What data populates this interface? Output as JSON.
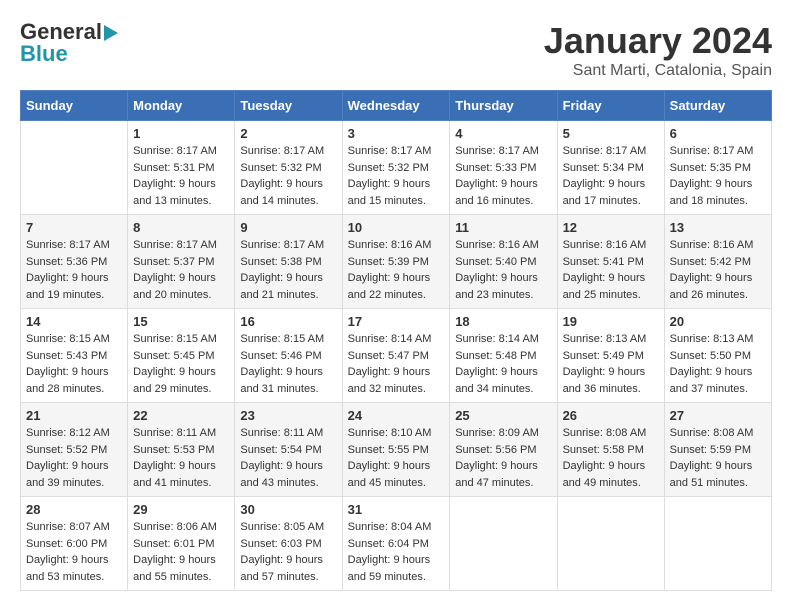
{
  "header": {
    "logo_line1": "General",
    "logo_line2": "Blue",
    "month": "January 2024",
    "location": "Sant Marti, Catalonia, Spain"
  },
  "weekdays": [
    "Sunday",
    "Monday",
    "Tuesday",
    "Wednesday",
    "Thursday",
    "Friday",
    "Saturday"
  ],
  "weeks": [
    [
      {
        "day": "",
        "info": ""
      },
      {
        "day": "1",
        "sunrise": "8:17 AM",
        "sunset": "5:31 PM",
        "daylight": "9 hours and 13 minutes."
      },
      {
        "day": "2",
        "sunrise": "8:17 AM",
        "sunset": "5:32 PM",
        "daylight": "9 hours and 14 minutes."
      },
      {
        "day": "3",
        "sunrise": "8:17 AM",
        "sunset": "5:32 PM",
        "daylight": "9 hours and 15 minutes."
      },
      {
        "day": "4",
        "sunrise": "8:17 AM",
        "sunset": "5:33 PM",
        "daylight": "9 hours and 16 minutes."
      },
      {
        "day": "5",
        "sunrise": "8:17 AM",
        "sunset": "5:34 PM",
        "daylight": "9 hours and 17 minutes."
      },
      {
        "day": "6",
        "sunrise": "8:17 AM",
        "sunset": "5:35 PM",
        "daylight": "9 hours and 18 minutes."
      }
    ],
    [
      {
        "day": "7",
        "sunrise": "8:17 AM",
        "sunset": "5:36 PM",
        "daylight": "9 hours and 19 minutes."
      },
      {
        "day": "8",
        "sunrise": "8:17 AM",
        "sunset": "5:37 PM",
        "daylight": "9 hours and 20 minutes."
      },
      {
        "day": "9",
        "sunrise": "8:17 AM",
        "sunset": "5:38 PM",
        "daylight": "9 hours and 21 minutes."
      },
      {
        "day": "10",
        "sunrise": "8:16 AM",
        "sunset": "5:39 PM",
        "daylight": "9 hours and 22 minutes."
      },
      {
        "day": "11",
        "sunrise": "8:16 AM",
        "sunset": "5:40 PM",
        "daylight": "9 hours and 23 minutes."
      },
      {
        "day": "12",
        "sunrise": "8:16 AM",
        "sunset": "5:41 PM",
        "daylight": "9 hours and 25 minutes."
      },
      {
        "day": "13",
        "sunrise": "8:16 AM",
        "sunset": "5:42 PM",
        "daylight": "9 hours and 26 minutes."
      }
    ],
    [
      {
        "day": "14",
        "sunrise": "8:15 AM",
        "sunset": "5:43 PM",
        "daylight": "9 hours and 28 minutes."
      },
      {
        "day": "15",
        "sunrise": "8:15 AM",
        "sunset": "5:45 PM",
        "daylight": "9 hours and 29 minutes."
      },
      {
        "day": "16",
        "sunrise": "8:15 AM",
        "sunset": "5:46 PM",
        "daylight": "9 hours and 31 minutes."
      },
      {
        "day": "17",
        "sunrise": "8:14 AM",
        "sunset": "5:47 PM",
        "daylight": "9 hours and 32 minutes."
      },
      {
        "day": "18",
        "sunrise": "8:14 AM",
        "sunset": "5:48 PM",
        "daylight": "9 hours and 34 minutes."
      },
      {
        "day": "19",
        "sunrise": "8:13 AM",
        "sunset": "5:49 PM",
        "daylight": "9 hours and 36 minutes."
      },
      {
        "day": "20",
        "sunrise": "8:13 AM",
        "sunset": "5:50 PM",
        "daylight": "9 hours and 37 minutes."
      }
    ],
    [
      {
        "day": "21",
        "sunrise": "8:12 AM",
        "sunset": "5:52 PM",
        "daylight": "9 hours and 39 minutes."
      },
      {
        "day": "22",
        "sunrise": "8:11 AM",
        "sunset": "5:53 PM",
        "daylight": "9 hours and 41 minutes."
      },
      {
        "day": "23",
        "sunrise": "8:11 AM",
        "sunset": "5:54 PM",
        "daylight": "9 hours and 43 minutes."
      },
      {
        "day": "24",
        "sunrise": "8:10 AM",
        "sunset": "5:55 PM",
        "daylight": "9 hours and 45 minutes."
      },
      {
        "day": "25",
        "sunrise": "8:09 AM",
        "sunset": "5:56 PM",
        "daylight": "9 hours and 47 minutes."
      },
      {
        "day": "26",
        "sunrise": "8:08 AM",
        "sunset": "5:58 PM",
        "daylight": "9 hours and 49 minutes."
      },
      {
        "day": "27",
        "sunrise": "8:08 AM",
        "sunset": "5:59 PM",
        "daylight": "9 hours and 51 minutes."
      }
    ],
    [
      {
        "day": "28",
        "sunrise": "8:07 AM",
        "sunset": "6:00 PM",
        "daylight": "9 hours and 53 minutes."
      },
      {
        "day": "29",
        "sunrise": "8:06 AM",
        "sunset": "6:01 PM",
        "daylight": "9 hours and 55 minutes."
      },
      {
        "day": "30",
        "sunrise": "8:05 AM",
        "sunset": "6:03 PM",
        "daylight": "9 hours and 57 minutes."
      },
      {
        "day": "31",
        "sunrise": "8:04 AM",
        "sunset": "6:04 PM",
        "daylight": "9 hours and 59 minutes."
      },
      {
        "day": "",
        "info": ""
      },
      {
        "day": "",
        "info": ""
      },
      {
        "day": "",
        "info": ""
      }
    ]
  ]
}
